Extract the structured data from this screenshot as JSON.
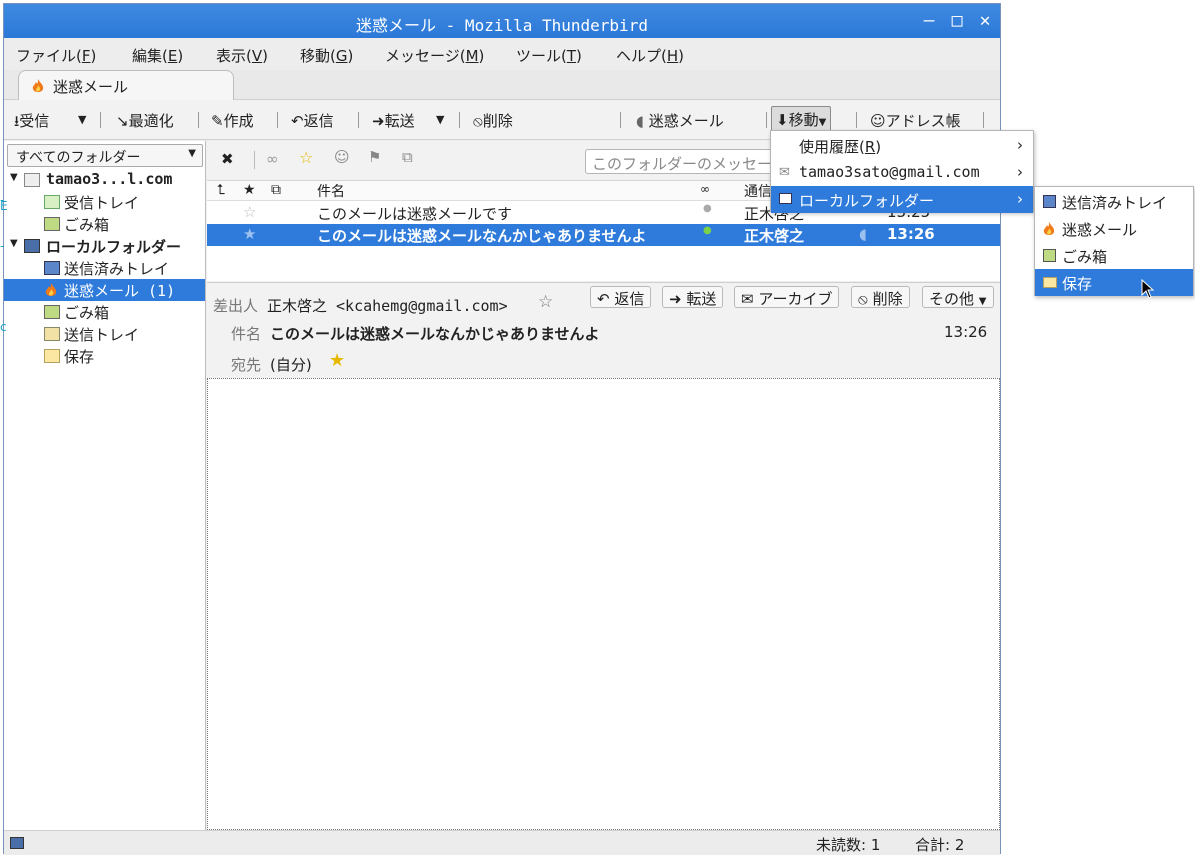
{
  "window": {
    "title": "迷惑メール - Mozilla Thunderbird"
  },
  "menubar": [
    {
      "label": "ファイル(",
      "key": "F"
    },
    {
      "label": "編集(",
      "key": "E"
    },
    {
      "label": "表示(",
      "key": "V"
    },
    {
      "label": "移動(",
      "key": "G"
    },
    {
      "label": "メッセージ(",
      "key": "M"
    },
    {
      "label": "ツール(",
      "key": "T"
    },
    {
      "label": "ヘルプ(",
      "key": "H"
    }
  ],
  "tab": {
    "label": "迷惑メール"
  },
  "toolbar": {
    "get_mail": "受信",
    "compact": "最適化",
    "write": "作成",
    "reply": "返信",
    "forward": "転送",
    "delete": "削除",
    "junk": "迷惑メール",
    "move": "移動",
    "address_book": "アドレス帳"
  },
  "folder_pane": {
    "selector": "すべてのフォルダー",
    "folders": [
      {
        "label": "tamao3...l.com",
        "level": 0,
        "bold": true,
        "icon": "account-icon"
      },
      {
        "label": "受信トレイ",
        "level": 1,
        "icon": "inbox-icon"
      },
      {
        "label": "ごみ箱",
        "level": 1,
        "icon": "trash-icon"
      },
      {
        "label": "ローカルフォルダー",
        "level": 0,
        "bold": true,
        "icon": "computer-icon"
      },
      {
        "label": "送信済みトレイ",
        "level": 1,
        "icon": "sent-icon"
      },
      {
        "label": "迷惑メール (1)",
        "level": 1,
        "icon": "junk-flame-icon",
        "selected": true
      },
      {
        "label": "ごみ箱",
        "level": 1,
        "icon": "trash-icon"
      },
      {
        "label": "送信トレイ",
        "level": 1,
        "icon": "outbox-icon"
      },
      {
        "label": "保存",
        "level": 1,
        "icon": "folder-icon"
      }
    ]
  },
  "thread_pane": {
    "search_placeholder": "このフォルダーのメッセージ",
    "columns": {
      "subject": "件名",
      "correspondent": "通信"
    },
    "messages": [
      {
        "subject": "このメールは迷惑メールです",
        "from": "正木啓之",
        "time": "13:25",
        "selected": false
      },
      {
        "subject": "このメールは迷惑メールなんかじゃありませんよ",
        "from": "正木啓之",
        "time": "13:26",
        "selected": true
      }
    ]
  },
  "message_header": {
    "from_label": "差出人",
    "from_value": "正木啓之 <kcahemg@gmail.com>",
    "subject_label": "件名",
    "subject_value": "このメールは迷惑メールなんかじゃありませんよ",
    "to_label": "宛先",
    "to_value": "(自分)",
    "time": "13:26",
    "buttons": {
      "reply": "返信",
      "forward": "転送",
      "archive": "アーカイブ",
      "delete": "削除",
      "other": "その他"
    }
  },
  "status_bar": {
    "unread": "未読数: 1",
    "total": "合計: 2"
  },
  "move_menu": {
    "items": [
      {
        "label": "使用履歴(",
        "key": "R",
        "suffix": ")"
      },
      {
        "label": "tamao3sato@gmail.com"
      },
      {
        "label": "ローカルフォルダー",
        "highlighted": true
      }
    ]
  },
  "local_folders_submenu": {
    "items": [
      {
        "label": "送信済みトレイ",
        "icon": "sent-icon"
      },
      {
        "label": "迷惑メール",
        "icon": "junk-flame-icon"
      },
      {
        "label": "ごみ箱",
        "icon": "trash-icon"
      },
      {
        "label": "保存",
        "icon": "folder-icon",
        "highlighted": true
      }
    ]
  },
  "colors": {
    "titlebar": "#2b78d8",
    "selection": "#2e7bdb"
  }
}
